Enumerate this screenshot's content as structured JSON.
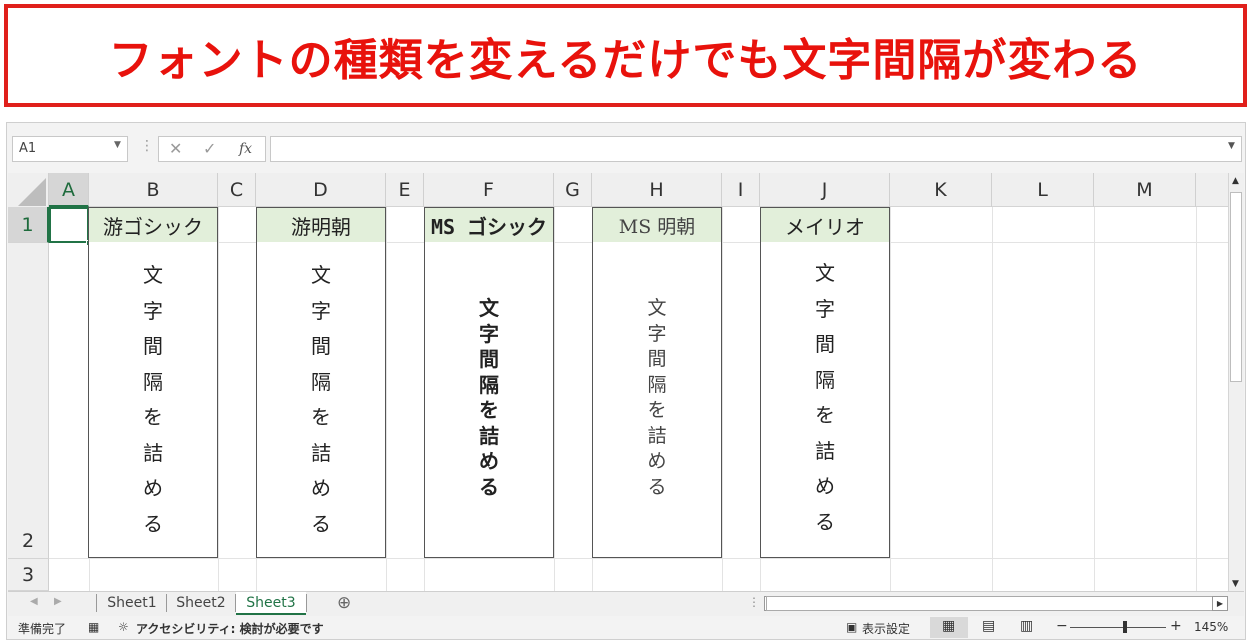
{
  "banner": {
    "text": "フォントの種類を変えるだけでも文字間隔が変わる"
  },
  "formula_bar": {
    "name_box": "A1",
    "cancel_icon": "✕",
    "enter_icon": "✓",
    "fx_icon": "fx",
    "formula": ""
  },
  "columns": [
    "A",
    "B",
    "C",
    "D",
    "E",
    "F",
    "G",
    "H",
    "I",
    "J",
    "K",
    "L",
    "M"
  ],
  "rows": [
    "1",
    "2",
    "3"
  ],
  "fonts": [
    {
      "col": "B",
      "name": "游ゴシック",
      "text": [
        "文",
        "字",
        "間",
        "隔",
        "を",
        "詰",
        "め",
        "る"
      ]
    },
    {
      "col": "D",
      "name": "游明朝",
      "text": [
        "文",
        "字",
        "間",
        "隔",
        "を",
        "詰",
        "め",
        "る"
      ]
    },
    {
      "col": "F",
      "name": "MS ゴシック",
      "text": [
        "文",
        "字",
        "間",
        "隔",
        "を",
        "詰",
        "め",
        "る"
      ]
    },
    {
      "col": "H",
      "name": "MS 明朝",
      "text": [
        "文",
        "字",
        "間",
        "隔",
        "を",
        "詰",
        "め",
        "る"
      ]
    },
    {
      "col": "J",
      "name": "メイリオ",
      "text": [
        "文",
        "字",
        "間",
        "隔",
        "を",
        "詰",
        "め",
        "る"
      ]
    }
  ],
  "sheets": [
    "Sheet1",
    "Sheet2",
    "Sheet3"
  ],
  "active_sheet": "Sheet3",
  "add_sheet": "⊕",
  "status": {
    "ready": "準備完了",
    "accessibility": "アクセシビリティ: 検討が必要です",
    "display_settings": "表示設定",
    "zoom": "145%"
  },
  "colors": {
    "accent": "#217346",
    "banner_red": "#e8120c",
    "header_fill": "#e2efda"
  }
}
